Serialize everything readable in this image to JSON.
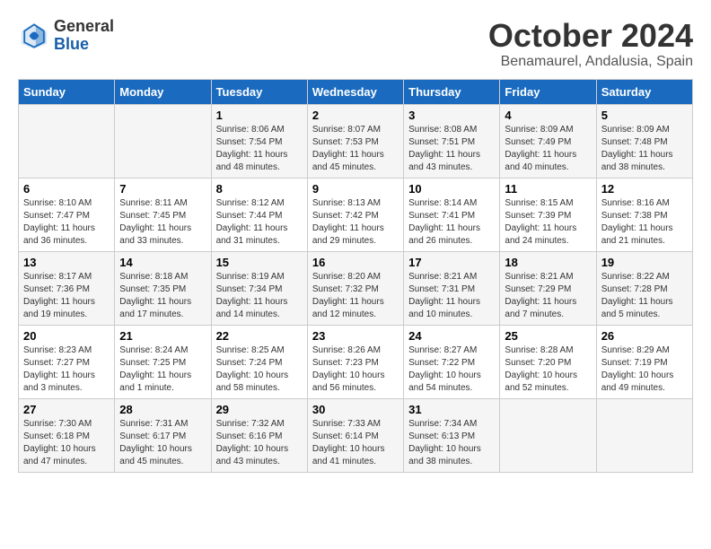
{
  "header": {
    "logo_line1": "General",
    "logo_line2": "Blue",
    "month": "October 2024",
    "location": "Benamaurel, Andalusia, Spain"
  },
  "days_of_week": [
    "Sunday",
    "Monday",
    "Tuesday",
    "Wednesday",
    "Thursday",
    "Friday",
    "Saturday"
  ],
  "weeks": [
    [
      {
        "day": "",
        "sunrise": "",
        "sunset": "",
        "daylight": ""
      },
      {
        "day": "",
        "sunrise": "",
        "sunset": "",
        "daylight": ""
      },
      {
        "day": "1",
        "sunrise": "Sunrise: 8:06 AM",
        "sunset": "Sunset: 7:54 PM",
        "daylight": "Daylight: 11 hours and 48 minutes."
      },
      {
        "day": "2",
        "sunrise": "Sunrise: 8:07 AM",
        "sunset": "Sunset: 7:53 PM",
        "daylight": "Daylight: 11 hours and 45 minutes."
      },
      {
        "day": "3",
        "sunrise": "Sunrise: 8:08 AM",
        "sunset": "Sunset: 7:51 PM",
        "daylight": "Daylight: 11 hours and 43 minutes."
      },
      {
        "day": "4",
        "sunrise": "Sunrise: 8:09 AM",
        "sunset": "Sunset: 7:49 PM",
        "daylight": "Daylight: 11 hours and 40 minutes."
      },
      {
        "day": "5",
        "sunrise": "Sunrise: 8:09 AM",
        "sunset": "Sunset: 7:48 PM",
        "daylight": "Daylight: 11 hours and 38 minutes."
      }
    ],
    [
      {
        "day": "6",
        "sunrise": "Sunrise: 8:10 AM",
        "sunset": "Sunset: 7:47 PM",
        "daylight": "Daylight: 11 hours and 36 minutes."
      },
      {
        "day": "7",
        "sunrise": "Sunrise: 8:11 AM",
        "sunset": "Sunset: 7:45 PM",
        "daylight": "Daylight: 11 hours and 33 minutes."
      },
      {
        "day": "8",
        "sunrise": "Sunrise: 8:12 AM",
        "sunset": "Sunset: 7:44 PM",
        "daylight": "Daylight: 11 hours and 31 minutes."
      },
      {
        "day": "9",
        "sunrise": "Sunrise: 8:13 AM",
        "sunset": "Sunset: 7:42 PM",
        "daylight": "Daylight: 11 hours and 29 minutes."
      },
      {
        "day": "10",
        "sunrise": "Sunrise: 8:14 AM",
        "sunset": "Sunset: 7:41 PM",
        "daylight": "Daylight: 11 hours and 26 minutes."
      },
      {
        "day": "11",
        "sunrise": "Sunrise: 8:15 AM",
        "sunset": "Sunset: 7:39 PM",
        "daylight": "Daylight: 11 hours and 24 minutes."
      },
      {
        "day": "12",
        "sunrise": "Sunrise: 8:16 AM",
        "sunset": "Sunset: 7:38 PM",
        "daylight": "Daylight: 11 hours and 21 minutes."
      }
    ],
    [
      {
        "day": "13",
        "sunrise": "Sunrise: 8:17 AM",
        "sunset": "Sunset: 7:36 PM",
        "daylight": "Daylight: 11 hours and 19 minutes."
      },
      {
        "day": "14",
        "sunrise": "Sunrise: 8:18 AM",
        "sunset": "Sunset: 7:35 PM",
        "daylight": "Daylight: 11 hours and 17 minutes."
      },
      {
        "day": "15",
        "sunrise": "Sunrise: 8:19 AM",
        "sunset": "Sunset: 7:34 PM",
        "daylight": "Daylight: 11 hours and 14 minutes."
      },
      {
        "day": "16",
        "sunrise": "Sunrise: 8:20 AM",
        "sunset": "Sunset: 7:32 PM",
        "daylight": "Daylight: 11 hours and 12 minutes."
      },
      {
        "day": "17",
        "sunrise": "Sunrise: 8:21 AM",
        "sunset": "Sunset: 7:31 PM",
        "daylight": "Daylight: 11 hours and 10 minutes."
      },
      {
        "day": "18",
        "sunrise": "Sunrise: 8:21 AM",
        "sunset": "Sunset: 7:29 PM",
        "daylight": "Daylight: 11 hours and 7 minutes."
      },
      {
        "day": "19",
        "sunrise": "Sunrise: 8:22 AM",
        "sunset": "Sunset: 7:28 PM",
        "daylight": "Daylight: 11 hours and 5 minutes."
      }
    ],
    [
      {
        "day": "20",
        "sunrise": "Sunrise: 8:23 AM",
        "sunset": "Sunset: 7:27 PM",
        "daylight": "Daylight: 11 hours and 3 minutes."
      },
      {
        "day": "21",
        "sunrise": "Sunrise: 8:24 AM",
        "sunset": "Sunset: 7:25 PM",
        "daylight": "Daylight: 11 hours and 1 minute."
      },
      {
        "day": "22",
        "sunrise": "Sunrise: 8:25 AM",
        "sunset": "Sunset: 7:24 PM",
        "daylight": "Daylight: 10 hours and 58 minutes."
      },
      {
        "day": "23",
        "sunrise": "Sunrise: 8:26 AM",
        "sunset": "Sunset: 7:23 PM",
        "daylight": "Daylight: 10 hours and 56 minutes."
      },
      {
        "day": "24",
        "sunrise": "Sunrise: 8:27 AM",
        "sunset": "Sunset: 7:22 PM",
        "daylight": "Daylight: 10 hours and 54 minutes."
      },
      {
        "day": "25",
        "sunrise": "Sunrise: 8:28 AM",
        "sunset": "Sunset: 7:20 PM",
        "daylight": "Daylight: 10 hours and 52 minutes."
      },
      {
        "day": "26",
        "sunrise": "Sunrise: 8:29 AM",
        "sunset": "Sunset: 7:19 PM",
        "daylight": "Daylight: 10 hours and 49 minutes."
      }
    ],
    [
      {
        "day": "27",
        "sunrise": "Sunrise: 7:30 AM",
        "sunset": "Sunset: 6:18 PM",
        "daylight": "Daylight: 10 hours and 47 minutes."
      },
      {
        "day": "28",
        "sunrise": "Sunrise: 7:31 AM",
        "sunset": "Sunset: 6:17 PM",
        "daylight": "Daylight: 10 hours and 45 minutes."
      },
      {
        "day": "29",
        "sunrise": "Sunrise: 7:32 AM",
        "sunset": "Sunset: 6:16 PM",
        "daylight": "Daylight: 10 hours and 43 minutes."
      },
      {
        "day": "30",
        "sunrise": "Sunrise: 7:33 AM",
        "sunset": "Sunset: 6:14 PM",
        "daylight": "Daylight: 10 hours and 41 minutes."
      },
      {
        "day": "31",
        "sunrise": "Sunrise: 7:34 AM",
        "sunset": "Sunset: 6:13 PM",
        "daylight": "Daylight: 10 hours and 38 minutes."
      },
      {
        "day": "",
        "sunrise": "",
        "sunset": "",
        "daylight": ""
      },
      {
        "day": "",
        "sunrise": "",
        "sunset": "",
        "daylight": ""
      }
    ]
  ]
}
